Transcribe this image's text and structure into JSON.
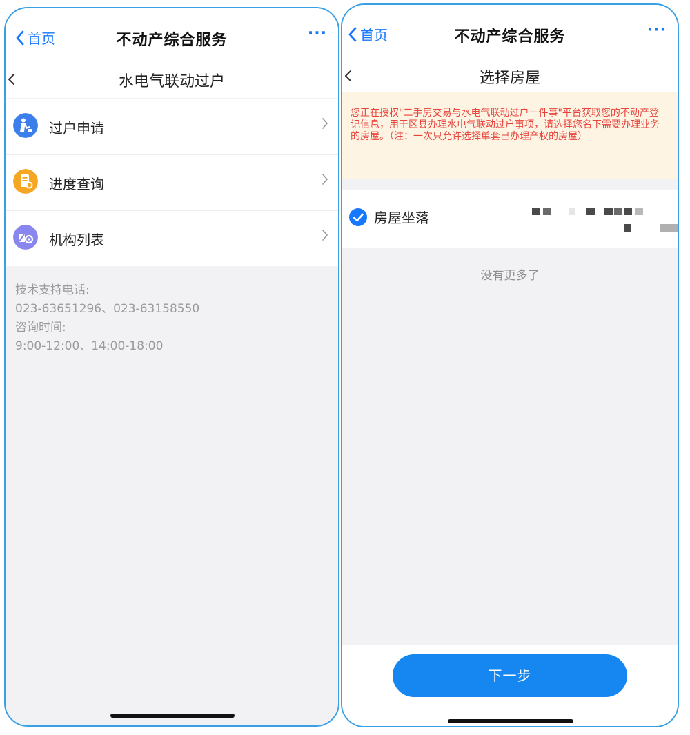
{
  "left_screen": {
    "header": {
      "back_label": "首页",
      "title": "不动产综合服务",
      "more": "···"
    },
    "page_title": "水电气联动过户",
    "menu": [
      {
        "label": "过户申请",
        "icon": "person-transfer-icon",
        "color": "#3d7fea"
      },
      {
        "label": "进度查询",
        "icon": "document-search-icon",
        "color": "#f5a623"
      },
      {
        "label": "机构列表",
        "icon": "institution-icon",
        "color": "#8a86f0"
      }
    ],
    "support": {
      "phone_label": "技术支持电话:",
      "phones": "023-63651296、023-63158550",
      "hours_label": "咨询时间:",
      "hours": "9:00-12:00、14:00-18:00"
    }
  },
  "right_screen": {
    "header": {
      "back_label": "首页",
      "title": "不动产综合服务",
      "more": "···"
    },
    "page_title": "选择房屋",
    "notice": "您正在授权\"二手房交易与水电气联动过户一件事\"平台获取您的不动产登记信息，用于区县办理水电气联动过户事项，请选择您名下需要办理业务的房屋。（注：一次只允许选择单套已办理产权的房屋）",
    "house": {
      "label": "房屋坐落",
      "checked": true
    },
    "no_more": "没有更多了",
    "next_button": "下一步"
  },
  "colors": {
    "accent": "#1677ff",
    "frame": "#3aa0e6",
    "notice_text": "#e8443c",
    "notice_bg": "#fdf4e3",
    "button": "#1687f0"
  }
}
